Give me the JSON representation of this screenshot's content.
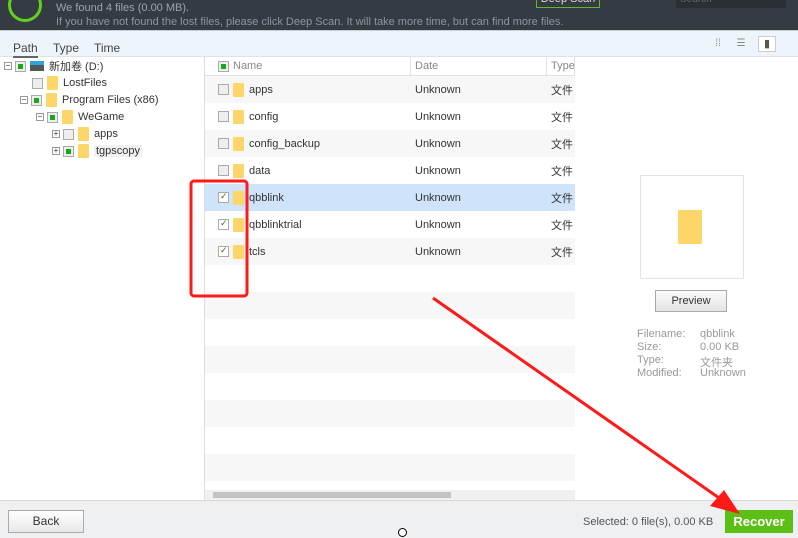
{
  "header": {
    "found_text": "We found 4 files (0.00 MB).",
    "hint_text": "If you have not found the lost files, please click Deep Scan. It will take more time, but can find more files.",
    "deep_scan_label": "Deep Scan",
    "search_placeholder": "Search"
  },
  "tabs": [
    {
      "label": "Path"
    },
    {
      "label": "Type"
    },
    {
      "label": "Time"
    }
  ],
  "view_icons": [
    "grid-view-icon",
    "list-view-icon",
    "preview-view-icon"
  ],
  "tree": [
    {
      "label": "新加卷 (D:)",
      "state": "partial"
    },
    {
      "label": "LostFiles",
      "state": "unchecked"
    },
    {
      "label": "Program Files (x86)",
      "state": "partial"
    },
    {
      "label": "WeGame",
      "state": "partial"
    },
    {
      "label": "apps",
      "state": "unchecked"
    },
    {
      "label": "tgpscopy",
      "state": "partial"
    }
  ],
  "list": {
    "columns": [
      "Name",
      "Date",
      "Type"
    ],
    "rows": [
      {
        "name": "apps",
        "date": "Unknown",
        "type": "文件",
        "checked": false
      },
      {
        "name": "config",
        "date": "Unknown",
        "type": "文件",
        "checked": false
      },
      {
        "name": "config_backup",
        "date": "Unknown",
        "type": "文件",
        "checked": false
      },
      {
        "name": "data",
        "date": "Unknown",
        "type": "文件",
        "checked": false
      },
      {
        "name": "qbblink",
        "date": "Unknown",
        "type": "文件",
        "checked": true,
        "selected": true
      },
      {
        "name": "qbblinktrial",
        "date": "Unknown",
        "type": "文件",
        "checked": true
      },
      {
        "name": "tcls",
        "date": "Unknown",
        "type": "文件",
        "checked": true
      }
    ]
  },
  "preview": {
    "button_label": "Preview",
    "fields": [
      {
        "label": "Filename:",
        "value": "qbblink"
      },
      {
        "label": "Size:",
        "value": "0.00 KB"
      },
      {
        "label": "Type:",
        "value": "文件夹"
      },
      {
        "label": "Modified:",
        "value": "Unknown"
      }
    ]
  },
  "bottom": {
    "back_label": "Back",
    "selected_text": "Selected: 0 file(s), 0.00 KB",
    "recover_label": "Recover"
  },
  "colors": {
    "accent": "#5cbf16",
    "annotation": "#ff1a1a",
    "header_bg": "#353b42",
    "selected_row": "#cfe3fb"
  }
}
